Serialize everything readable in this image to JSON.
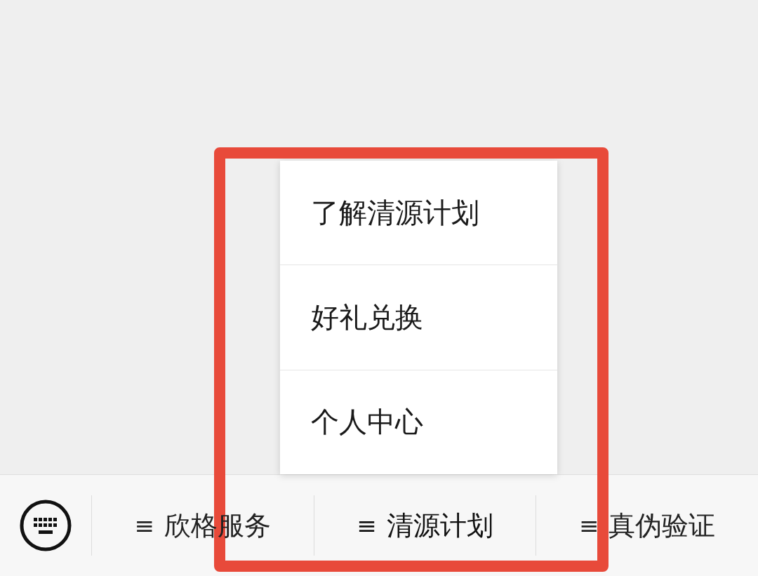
{
  "popup_menu": {
    "items": [
      {
        "label": "了解清源计划"
      },
      {
        "label": "好礼兑换"
      },
      {
        "label": "个人中心"
      }
    ]
  },
  "bottom_bar": {
    "menus": [
      {
        "icon": "≡",
        "label": "欣格服务",
        "selected": false
      },
      {
        "icon": "≡",
        "label": "清源计划",
        "selected": true
      },
      {
        "icon": "≡",
        "label": "真伪验证",
        "selected": false
      }
    ]
  },
  "annotation": {
    "kind": "highlight-frame"
  }
}
